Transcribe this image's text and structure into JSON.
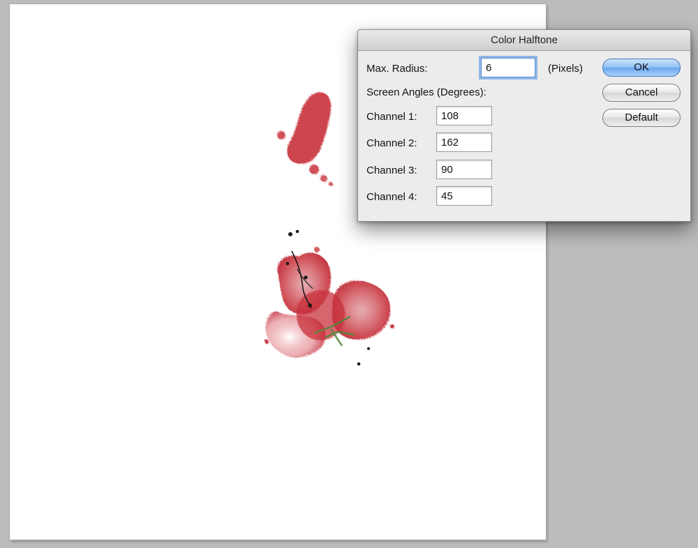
{
  "dialog": {
    "title": "Color Halftone",
    "max_radius": {
      "label": "Max. Radius:",
      "value": "6",
      "unit": "(Pixels)"
    },
    "screen_angles_label": "Screen Angles (Degrees):",
    "channels": [
      {
        "label": "Channel 1:",
        "value": "108"
      },
      {
        "label": "Channel 2:",
        "value": "162"
      },
      {
        "label": "Channel 3:",
        "value": "90"
      },
      {
        "label": "Channel 4:",
        "value": "45"
      }
    ],
    "buttons": {
      "ok": "OK",
      "cancel": "Cancel",
      "default": "Default"
    }
  },
  "colors": {
    "paint_red": "#c8323c",
    "workspace_gray": "#bcbcbc",
    "default_button_blue": "#6aa6ec"
  }
}
